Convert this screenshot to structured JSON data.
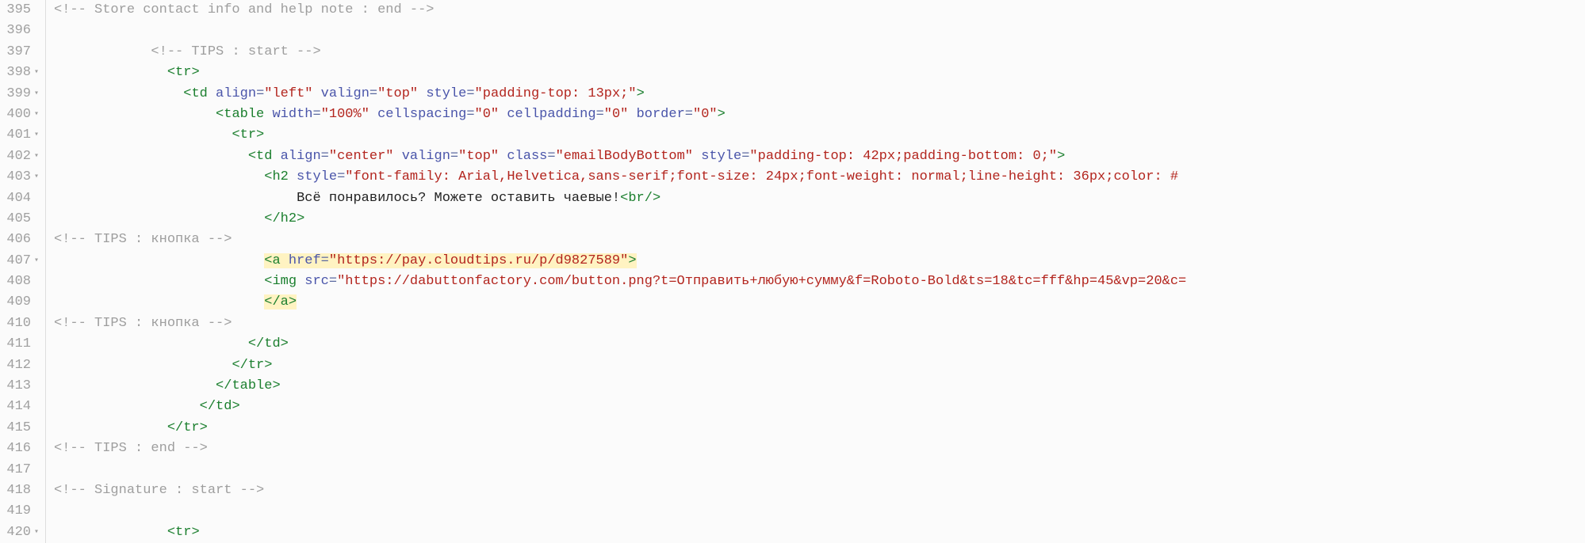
{
  "gutter": {
    "lines": [
      {
        "n": "395",
        "fold": ""
      },
      {
        "n": "396",
        "fold": ""
      },
      {
        "n": "397",
        "fold": ""
      },
      {
        "n": "398",
        "fold": "▾"
      },
      {
        "n": "399",
        "fold": "▾"
      },
      {
        "n": "400",
        "fold": "▾"
      },
      {
        "n": "401",
        "fold": "▾"
      },
      {
        "n": "402",
        "fold": "▾"
      },
      {
        "n": "403",
        "fold": "▾"
      },
      {
        "n": "404",
        "fold": ""
      },
      {
        "n": "405",
        "fold": ""
      },
      {
        "n": "406",
        "fold": ""
      },
      {
        "n": "407",
        "fold": "▾"
      },
      {
        "n": "408",
        "fold": ""
      },
      {
        "n": "409",
        "fold": ""
      },
      {
        "n": "410",
        "fold": ""
      },
      {
        "n": "411",
        "fold": ""
      },
      {
        "n": "412",
        "fold": ""
      },
      {
        "n": "413",
        "fold": ""
      },
      {
        "n": "414",
        "fold": ""
      },
      {
        "n": "415",
        "fold": ""
      },
      {
        "n": "416",
        "fold": ""
      },
      {
        "n": "417",
        "fold": ""
      },
      {
        "n": "418",
        "fold": ""
      },
      {
        "n": "419",
        "fold": ""
      },
      {
        "n": "420",
        "fold": "▾"
      }
    ]
  },
  "code": {
    "l395_comment": "<!-- Store contact info and help note : end -->",
    "l397_comment": "<!-- TIPS : start -->",
    "l398_tag_open": "<",
    "l398_tag_name": "tr",
    "l398_tag_close": ">",
    "l399_pre": "<",
    "l399_tag": "td",
    "l399_a1": " align",
    "l399_eq": "=",
    "l399_v1": "\"left\"",
    "l399_a2": " valign",
    "l399_v2": "\"top\"",
    "l399_a3": " style",
    "l399_v3": "\"padding-top: 13px;\"",
    "l399_end": ">",
    "l400_tag": "table",
    "l400_a1": " width",
    "l400_v1": "\"100%\"",
    "l400_a2": " cellspacing",
    "l400_v2": "\"0\"",
    "l400_a3": " cellpadding",
    "l400_v3": "\"0\"",
    "l400_a4": " border",
    "l400_v4": "\"0\"",
    "l401_tag": "tr",
    "l402_tag": "td",
    "l402_a1": " align",
    "l402_v1": "\"center\"",
    "l402_a2": " valign",
    "l402_v2": "\"top\"",
    "l402_a3": " class",
    "l402_v3": "\"emailBodyBottom\"",
    "l402_a4": " style",
    "l402_v4": "\"padding-top: 42px;padding-bottom: 0;\"",
    "l403_tag": "h2",
    "l403_a1": " style",
    "l403_v1": "\"font-family: Arial,Helvetica,sans-serif;font-size: 24px;font-weight: normal;line-height: 36px;color: #",
    "l404_text": "Всё понравилось? Можете оставить чаевые!",
    "l404_br_open": "<",
    "l404_br": "br",
    "l404_br_slash": "/>",
    "l405_close": "</",
    "l405_tag": "h2",
    "l405_end": ">",
    "l406_comment": "<!-- TIPS : кнопка -->",
    "l407_open": "<",
    "l407_tag": "a",
    "l407_a1": " href",
    "l407_v1": "\"https://pay.cloudtips.ru/p/d9827589\"",
    "l407_end": ">",
    "l408_open": "<",
    "l408_tag": "img",
    "l408_a1": " src",
    "l408_v1": "\"https://dabuttonfactory.com/button.png?t=Отправить+любую+сумму&f=Roboto-Bold&ts=18&tc=fff&hp=45&vp=20&c=",
    "l409_close": "</",
    "l409_tag": "a",
    "l409_end": ">",
    "l410_comment": "<!-- TIPS : кнопка -->",
    "l411_close": "</",
    "l411_tag": "td",
    "l412_tag": "tr",
    "l413_tag": "table",
    "l414_tag": "td",
    "l415_tag": "tr",
    "l416_comment": "<!-- TIPS : end -->",
    "l418_comment": "<!-- Signature : start -->",
    "l420_tag": "tr",
    "indent": {
      "i0": "",
      "i12": "            ",
      "i14": "              ",
      "i16": "                ",
      "i18": "                  ",
      "i20": "                    ",
      "i22": "                      ",
      "i24": "                        ",
      "i26": "                          ",
      "i28": "                            ",
      "i30": "                              ",
      "i32": "                                ",
      "i34": "                                  ",
      "i36": "                                    "
    }
  }
}
